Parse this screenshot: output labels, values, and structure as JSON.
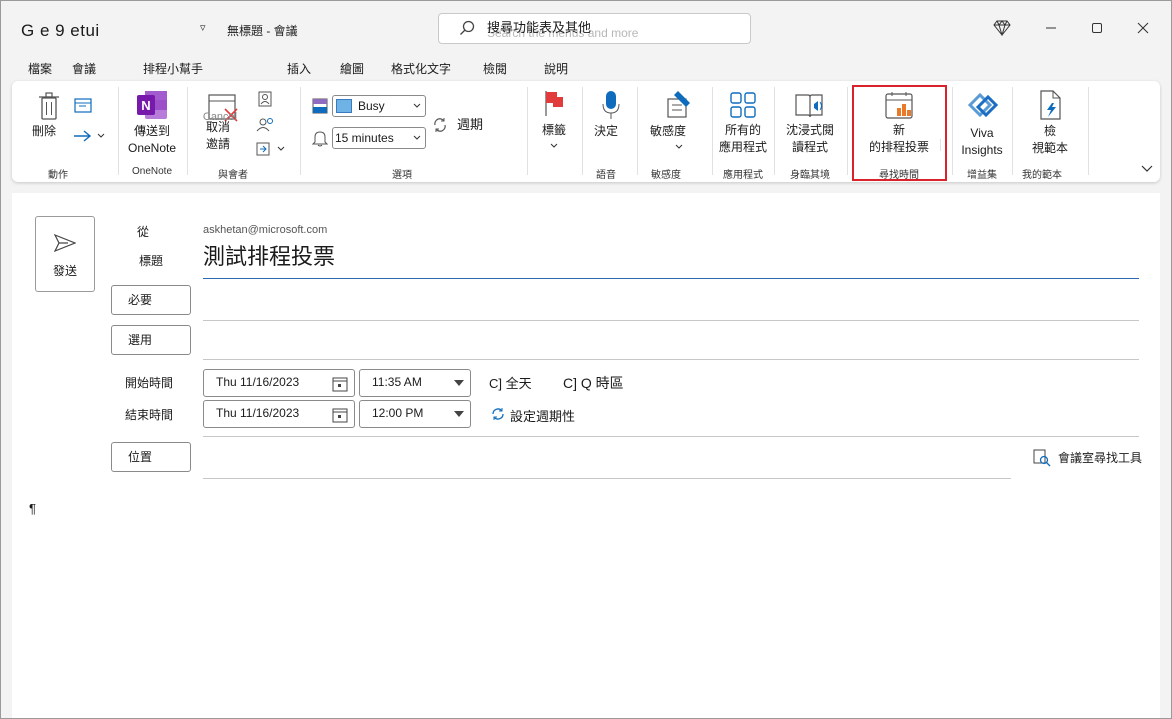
{
  "titlebar": {
    "app_title": "G e 9 etui",
    "qat_dropdown": "▿",
    "doc_title": "無標題  -  會議",
    "search_label": "搜尋功能表及其他",
    "search_ghost": "Search the menus and more"
  },
  "tabs": [
    "檔案",
    "會議",
    "排程小幫手",
    "插入",
    "繪圖",
    "格式化文字",
    "檢閱",
    "說明"
  ],
  "ribbon": {
    "actions": {
      "delete": "刪除",
      "group": "動作"
    },
    "onenote": {
      "send": "傳送到",
      "send2": "OneNote",
      "group": "OneNote"
    },
    "attendees": {
      "cancel": "取消",
      "cancel_en": "Cancel",
      "invite": "邀請",
      "group": "與會者"
    },
    "options": {
      "show_as": "Busy",
      "reminder": "15 minutes",
      "recurrence": "週期",
      "group": "選項"
    },
    "tags": {
      "label": "標籤"
    },
    "voice": {
      "dictate": "決定",
      "group": "語音"
    },
    "sensitivity": {
      "label": "敏感度",
      "group": "敏感度"
    },
    "apps": {
      "line1": "所有的",
      "line2": "應用程式",
      "group": "應用程式"
    },
    "immersive": {
      "line1": "沈浸式閱",
      "line2": "讀程式",
      "group": "身臨其境"
    },
    "findtime": {
      "line1": "新",
      "line2": "的排程投票",
      "group": "尋找時間"
    },
    "addins": {
      "line1": "Viva",
      "line2": "Insights",
      "group": "增益集"
    },
    "templates": {
      "line1": "檢",
      "line2": "視範本",
      "group": "我的範本"
    }
  },
  "form": {
    "send": "發送",
    "from_label": "從",
    "from_value": "askhetan@microsoft.com",
    "subject_label": "標題",
    "subject_value": "測試排程投票",
    "required": "必要",
    "optional": "選用",
    "start_label": "開始時間",
    "end_label": "結束時間",
    "start_date": "Thu 11/16/2023",
    "start_time": "11:35 AM",
    "end_date": "Thu 11/16/2023",
    "end_time": "12:00 PM",
    "all_day": "C] 全天",
    "timezone": "C] Q 時區",
    "set_recurrence": "設定週期性",
    "location": "位置",
    "room_finder": "會議室尋找工具",
    "body_mark": "¶"
  },
  "colors": {
    "accent": "#0f6cbd",
    "highlight": "#d9222a",
    "onenote": "#7719aa",
    "tag_red": "#e23b3b"
  }
}
